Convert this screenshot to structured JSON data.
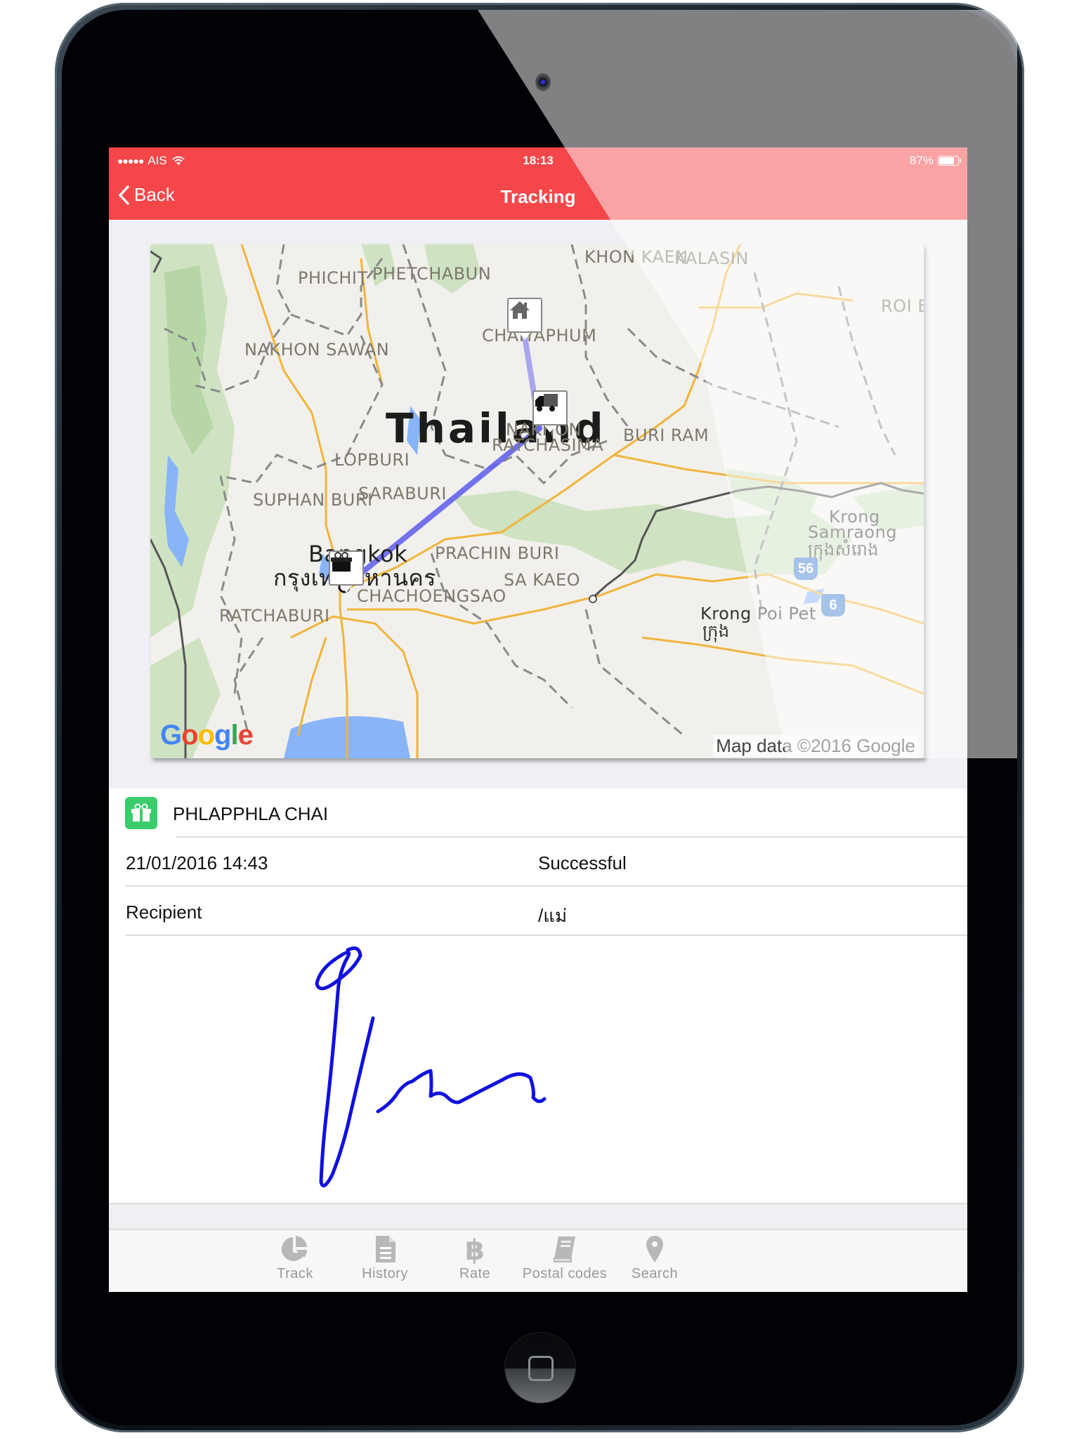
{
  "statusbar": {
    "signal_dots": "●●●●●",
    "carrier": "AIS",
    "time": "18:13",
    "battery_text": "87%",
    "battery_level": 0.87
  },
  "navbar": {
    "back_label": "Back",
    "title": "Tracking"
  },
  "map": {
    "country_label": "Thailand",
    "labels": {
      "phichit": "PHICHIT",
      "phetchabun": "PHETCHABUN",
      "khon_kaen": "KHON KAEN",
      "kalasin": "KALASIN",
      "roi_et": "ROI ET",
      "chaiyaphum": "CHAIYAPHUM",
      "nakhon_sawan": "NAKHON SAWAN",
      "nakhon_ratchasima_1": "NAKHON",
      "nakhon_ratchasima_2": "RATCHASIMA",
      "buri_ram": "BURI RAM",
      "lopburi": "LOPBURI",
      "suphan_buri": "SUPHAN BURI",
      "saraburi": "SARABURI",
      "bangkok": "Bangkok",
      "bangkok_thai": "กรุงเทพมหานคร",
      "prachin_buri": "PRACHIN BURI",
      "sa_kaeo": "SA KAEO",
      "chachoengsao": "CHACHOENGSAO",
      "ratchaburi": "RATCHABURI",
      "krong_samraong_1": "Krong",
      "krong_samraong_2": "Samraong",
      "krong_samraong_khmer": "ក្រុងសំរោង",
      "krong_poi_pet": "Krong Poi Pet",
      "krong_poi_pet_khmer": "ក្រុង"
    },
    "highway_shields": [
      "56",
      "6"
    ],
    "logo": "Google",
    "attribution": "Map data ©2016 Google",
    "route_color": "#5c5cf0",
    "markers": [
      "gift-origin",
      "truck-current",
      "home-destination"
    ]
  },
  "details": {
    "title": "PHLAPPHLA CHAI",
    "rows": [
      {
        "label": "21/01/2016 14:43",
        "value": "Successful"
      },
      {
        "label": "Recipient",
        "value": "/แม่"
      }
    ]
  },
  "signature": {
    "stroke_color": "#1010e0"
  },
  "tabs": [
    {
      "label": "Track",
      "icon": "pie-chart-icon"
    },
    {
      "label": "History",
      "icon": "document-icon"
    },
    {
      "label": "Rate",
      "icon": "bitcoin-icon"
    },
    {
      "label": "Postal codes",
      "icon": "book-icon"
    },
    {
      "label": "Search",
      "icon": "map-pin-icon"
    }
  ],
  "colors": {
    "accent": "#f5464a",
    "gift_badge": "#3acc6d",
    "tab_inactive": "#999999"
  }
}
